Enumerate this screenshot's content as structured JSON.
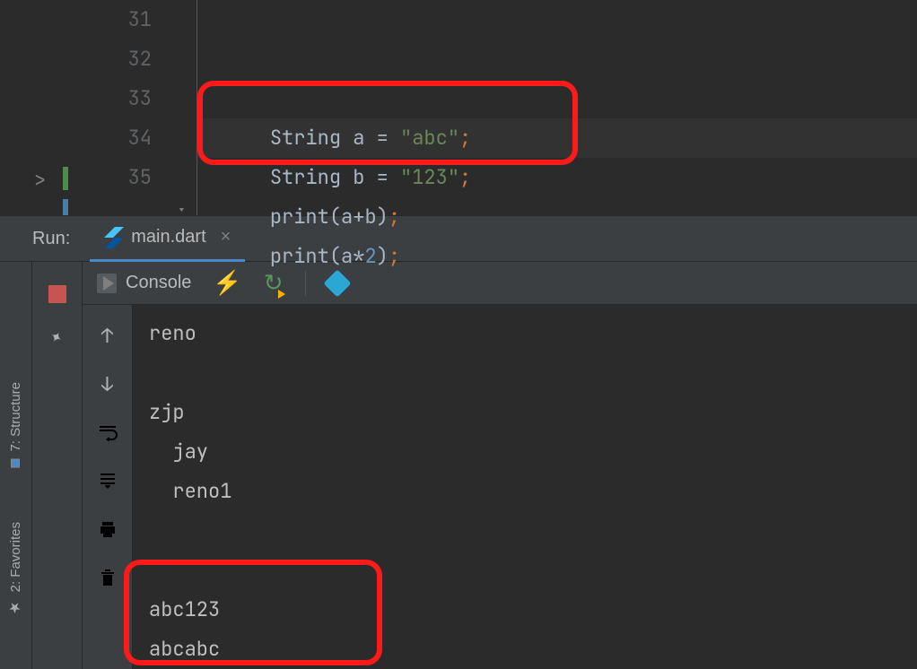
{
  "editor": {
    "lines": [
      {
        "num": "31",
        "indent": "    ",
        "tokens": [
          {
            "t": "String ",
            "c": "id"
          },
          {
            "t": "a ",
            "c": "id"
          },
          {
            "t": "= ",
            "c": "op"
          },
          {
            "t": "\"abc\"",
            "c": "str"
          },
          {
            "t": ";",
            "c": "semi"
          }
        ]
      },
      {
        "num": "32",
        "indent": "    ",
        "tokens": [
          {
            "t": "String ",
            "c": "id"
          },
          {
            "t": "b ",
            "c": "id"
          },
          {
            "t": "= ",
            "c": "op"
          },
          {
            "t": "\"123\"",
            "c": "str"
          },
          {
            "t": ";",
            "c": "semi"
          }
        ]
      },
      {
        "num": "33",
        "indent": "    ",
        "tokens": [
          {
            "t": "print",
            "c": "fn"
          },
          {
            "t": "(",
            "c": "op"
          },
          {
            "t": "a",
            "c": "id"
          },
          {
            "t": "+",
            "c": "op"
          },
          {
            "t": "b",
            "c": "id"
          },
          {
            "t": ")",
            "c": "op"
          },
          {
            "t": ";",
            "c": "semi"
          }
        ]
      },
      {
        "num": "34",
        "indent": "    ",
        "tokens": [
          {
            "t": "print",
            "c": "fn"
          },
          {
            "t": "(",
            "c": "op"
          },
          {
            "t": "a",
            "c": "id"
          },
          {
            "t": "*",
            "c": "op"
          },
          {
            "t": "2",
            "c": "num"
          },
          {
            "t": ")",
            "c": "op"
          },
          {
            "t": ";",
            "c": "semi"
          }
        ]
      },
      {
        "num": "35",
        "indent": "",
        "tokens": []
      }
    ],
    "expand_glyph": ">"
  },
  "run": {
    "label": "Run:",
    "tab": "main.dart",
    "console_label": "Console"
  },
  "side": {
    "structure": "7: Structure",
    "favorites": "2: Favorites"
  },
  "console": {
    "lines": [
      "reno",
      "",
      "zjp",
      "  jay",
      "  reno1",
      "",
      "",
      "abc123",
      "abcabc"
    ]
  }
}
